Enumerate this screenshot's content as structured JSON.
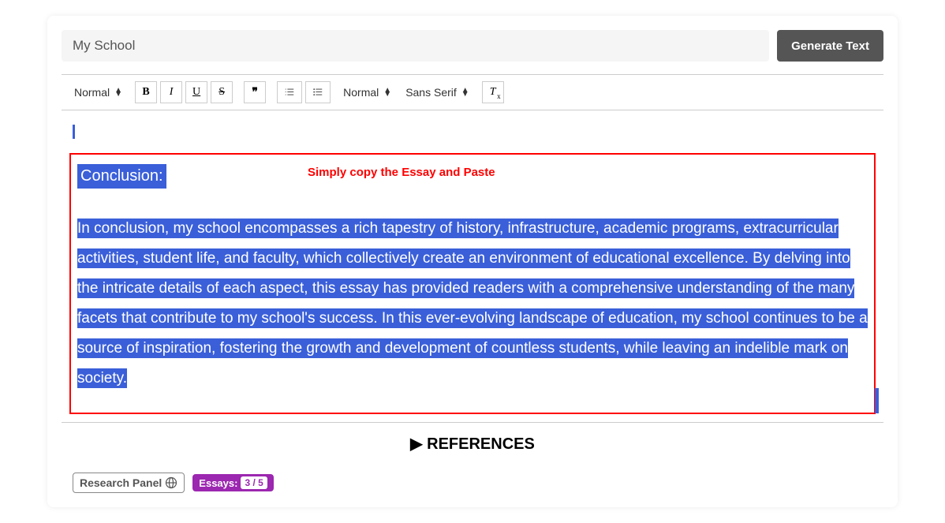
{
  "topic": {
    "placeholder": "My School",
    "value": "My School"
  },
  "generate_label": "Generate Text",
  "toolbar": {
    "heading": "Normal",
    "size": "Normal",
    "font": "Sans Serif"
  },
  "editor": {
    "conclusion_label": "Conclusion:",
    "copy_hint": "Simply copy the Essay and Paste",
    "body": "In conclusion, my school encompasses a rich tapestry of history, infrastructure, academic programs, extracurricular activities, student life, and faculty, which collectively create an environment of educational excellence. By delving into the intricate details of each aspect, this essay has provided readers with a comprehensive understanding of the many facets that contribute to my school's success. In this ever-evolving landscape of education, my school continues to be a source of inspiration, fostering the growth and development of countless students, while leaving an indelible mark on society."
  },
  "references_label": "REFERENCES",
  "research_panel_label": "Research Panel",
  "essays": {
    "label": "Essays:",
    "count": "3 / 5"
  }
}
